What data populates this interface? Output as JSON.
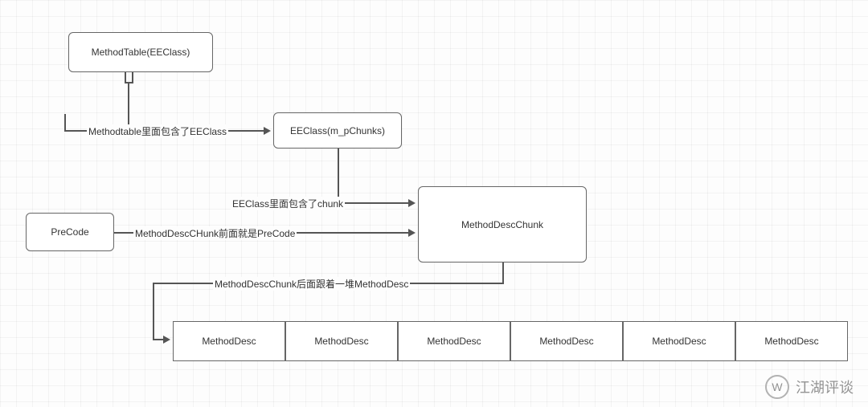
{
  "boxes": {
    "methodTable": "MethodTable(EEClass)",
    "eeClass": "EEClass(m_pChunks)",
    "preCode": "PreCode",
    "methodDescChunk": "MethodDescChunk",
    "methodDesc1": "MethodDesc",
    "methodDesc2": "MethodDesc",
    "methodDesc3": "MethodDesc",
    "methodDesc4": "MethodDesc",
    "methodDesc5": "MethodDesc",
    "methodDesc6": "MethodDesc"
  },
  "edges": {
    "mt_to_eeclass": "Methodtable里面包含了EEClass",
    "eeclass_to_chunk": "EEClass里面包含了chunk",
    "precode_to_chunk": "MethodDescCHunk前面就是PreCode",
    "chunk_to_desc": "MethodDescChunk后面跟着一堆MethodDesc"
  },
  "watermark": {
    "text": "江湖评谈",
    "icon": "W"
  },
  "chart_data": {
    "type": "diagram",
    "title": "",
    "nodes": [
      {
        "id": "MethodTable",
        "label": "MethodTable(EEClass)"
      },
      {
        "id": "EEClass",
        "label": "EEClass(m_pChunks)"
      },
      {
        "id": "PreCode",
        "label": "PreCode"
      },
      {
        "id": "MethodDescChunk",
        "label": "MethodDescChunk"
      },
      {
        "id": "MethodDesc_1",
        "label": "MethodDesc"
      },
      {
        "id": "MethodDesc_2",
        "label": "MethodDesc"
      },
      {
        "id": "MethodDesc_3",
        "label": "MethodDesc"
      },
      {
        "id": "MethodDesc_4",
        "label": "MethodDesc"
      },
      {
        "id": "MethodDesc_5",
        "label": "MethodDesc"
      },
      {
        "id": "MethodDesc_6",
        "label": "MethodDesc"
      }
    ],
    "edges": [
      {
        "from": "MethodTable",
        "to": "EEClass",
        "label": "Methodtable里面包含了EEClass"
      },
      {
        "from": "EEClass",
        "to": "MethodDescChunk",
        "label": "EEClass里面包含了chunk"
      },
      {
        "from": "PreCode",
        "to": "MethodDescChunk",
        "label": "MethodDescCHunk前面就是PreCode"
      },
      {
        "from": "MethodDescChunk",
        "to": "MethodDesc_1",
        "label": "MethodDescChunk后面跟着一堆MethodDesc"
      }
    ]
  }
}
